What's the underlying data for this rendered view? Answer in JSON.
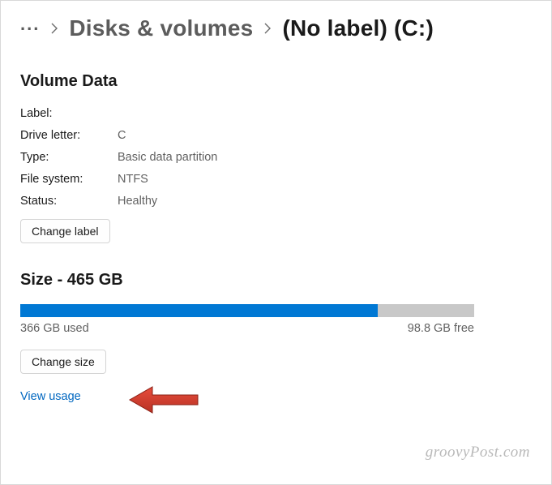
{
  "breadcrumb": {
    "parent": "Disks & volumes",
    "current": "(No label) (C:)"
  },
  "volume": {
    "title": "Volume Data",
    "labels": {
      "label": "Label:",
      "drive_letter": "Drive letter:",
      "type": "Type:",
      "file_system": "File system:",
      "status": "Status:"
    },
    "values": {
      "label": "",
      "drive_letter": "C",
      "type": "Basic data partition",
      "file_system": "NTFS",
      "status": "Healthy"
    },
    "change_label_btn": "Change label"
  },
  "size": {
    "title": "Size - 465 GB",
    "total_gb": 465,
    "used_gb": 366,
    "free_gb": 98.8,
    "used_text": "366 GB used",
    "free_text": "98.8 GB free",
    "fill_percent": 78.7,
    "change_size_btn": "Change size",
    "view_usage_link": "View usage"
  },
  "watermark": "groovyPost.com"
}
